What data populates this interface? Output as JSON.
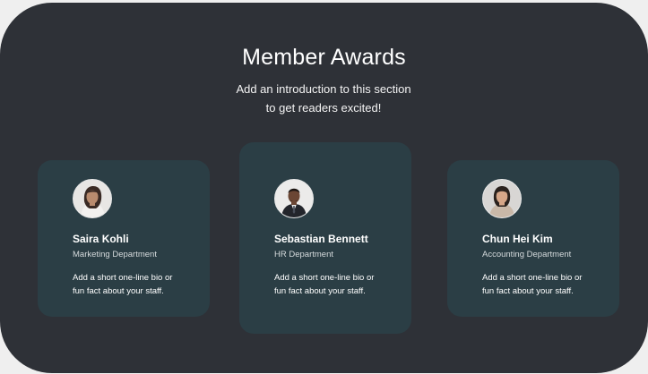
{
  "section": {
    "title": "Member Awards",
    "intro_line1": "Add an introduction to this section",
    "intro_line2": "to get readers excited!"
  },
  "members": [
    {
      "name": "Saira Kohli",
      "department": "Marketing Department",
      "bio_line1": "Add a short one-line bio or",
      "bio_line2": "fun fact about your staff.",
      "avatar_icon": "person-photo-icon"
    },
    {
      "name": "Sebastian Bennett",
      "department": "HR Department",
      "bio_line1": "Add a short one-line bio or",
      "bio_line2": "fun fact about your staff.",
      "avatar_icon": "person-photo-icon"
    },
    {
      "name": "Chun Hei Kim",
      "department": "Accounting Department",
      "bio_line1": "Add a short one-line bio or",
      "bio_line2": "fun fact about your staff.",
      "avatar_icon": "person-photo-icon"
    }
  ],
  "colors": {
    "background": "#2e3137",
    "card": "#2b3e45",
    "page": "#efefef",
    "text": "#ffffff"
  }
}
